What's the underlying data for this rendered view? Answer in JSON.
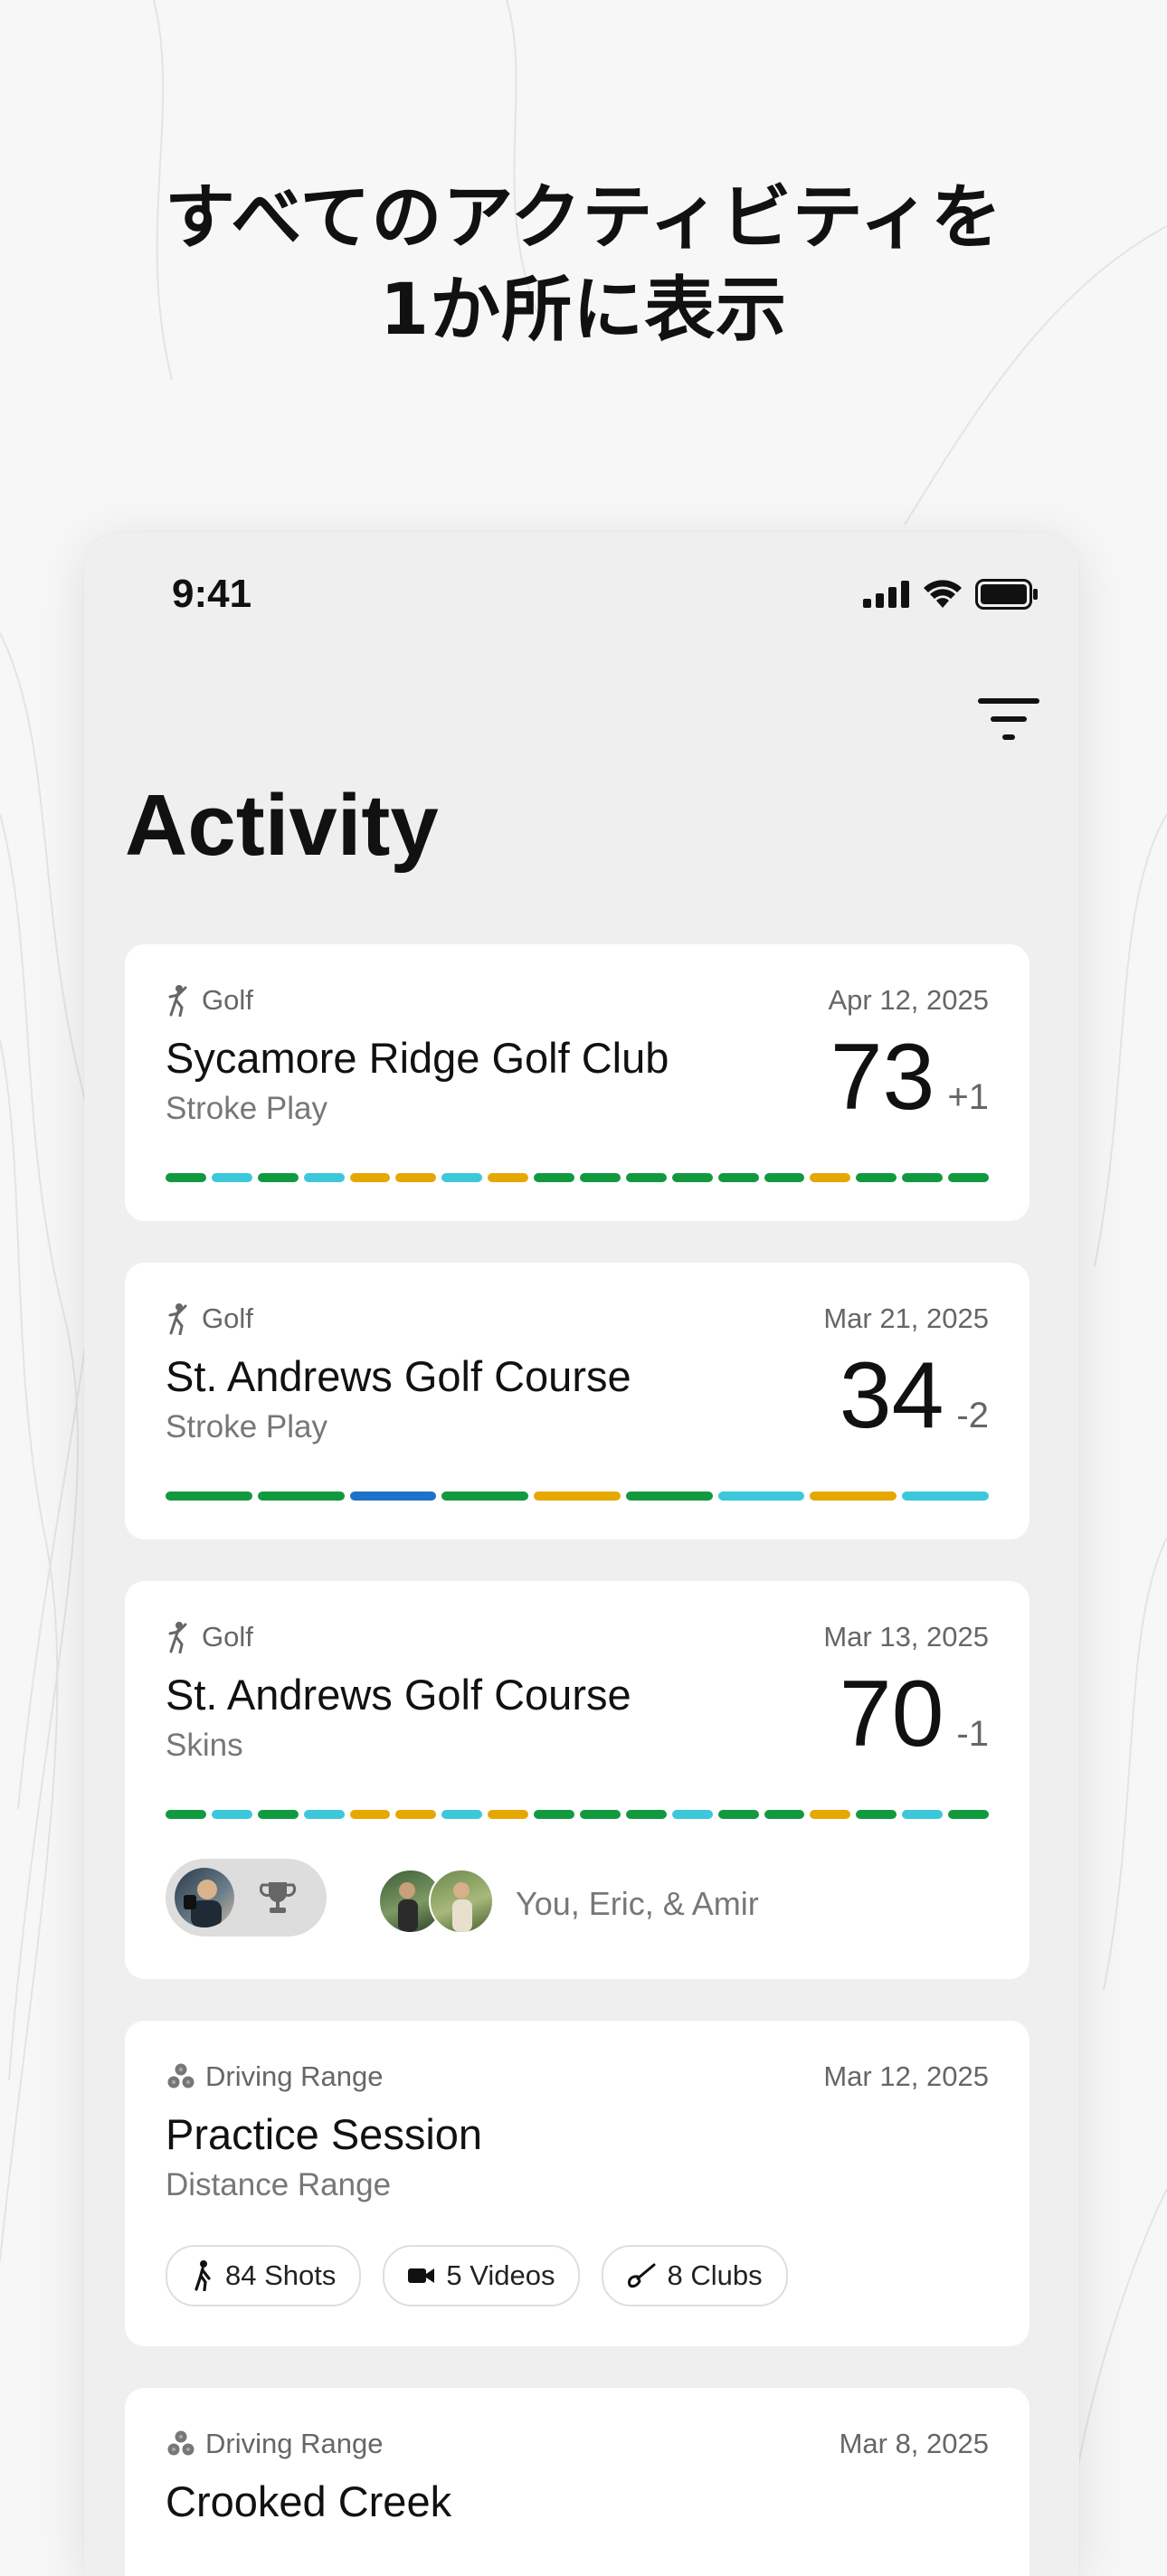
{
  "headline": {
    "line1": "すべてのアクティビティを",
    "line2": "1か所に表示"
  },
  "status_bar": {
    "time": "9:41"
  },
  "page_title": "Activity",
  "colors": {
    "birdie": "#3cc8da",
    "par": "#12993f",
    "bogey": "#e6a800",
    "eagle": "#1e73c8"
  },
  "activities": [
    {
      "type": "Golf",
      "date": "Apr 12, 2025",
      "name": "Sycamore Ridge Golf Club",
      "mode": "Stroke Play",
      "score": "73",
      "relative": "+1",
      "holes": [
        "par",
        "birdie",
        "par",
        "birdie",
        "bogey",
        "bogey",
        "birdie",
        "bogey",
        "par",
        "par",
        "par",
        "par",
        "par",
        "par",
        "bogey",
        "par",
        "par",
        "par"
      ]
    },
    {
      "type": "Golf",
      "date": "Mar 21, 2025",
      "name": "St. Andrews Golf Course",
      "mode": "Stroke Play",
      "score": "34",
      "relative": "-2",
      "holes": [
        "par",
        "par",
        "eagle",
        "par",
        "bogey",
        "par",
        "birdie",
        "bogey",
        "birdie"
      ]
    },
    {
      "type": "Golf",
      "date": "Mar 13, 2025",
      "name": "St. Andrews Golf Course",
      "mode": "Skins",
      "score": "70",
      "relative": "-1",
      "holes": [
        "par",
        "birdie",
        "par",
        "birdie",
        "bogey",
        "bogey",
        "birdie",
        "bogey",
        "par",
        "par",
        "par",
        "birdie",
        "par",
        "par",
        "bogey",
        "par",
        "birdie",
        "par"
      ],
      "players_label": "You, Eric, & Amir"
    },
    {
      "type": "Driving Range",
      "date": "Mar 12, 2025",
      "name": "Practice Session",
      "mode": "Distance Range",
      "chips": [
        {
          "icon": "golfer-icon",
          "label": "84 Shots"
        },
        {
          "icon": "video-camera-icon",
          "label": "5 Videos"
        },
        {
          "icon": "golf-club-icon",
          "label": "8 Clubs"
        }
      ]
    },
    {
      "type": "Driving Range",
      "date": "Mar 8, 2025",
      "name": "Crooked Creek"
    }
  ]
}
